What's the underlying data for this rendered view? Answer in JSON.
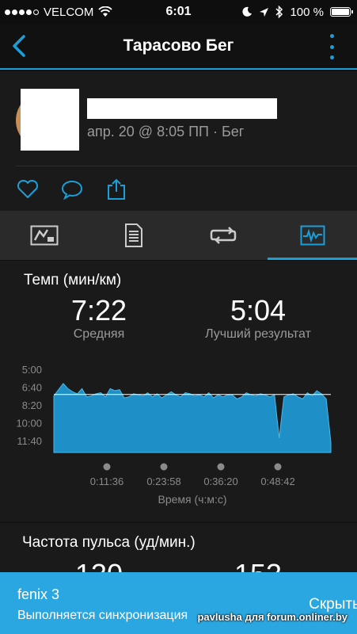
{
  "status_bar": {
    "carrier": "VELCOM",
    "time": "6:01",
    "battery": "100 %",
    "battery_level": 1.0,
    "signal_bars": 4
  },
  "header": {
    "title": "Тарасово Бег"
  },
  "activity": {
    "meta": "апр. 20 @ 8:05 ПП · Бег"
  },
  "icons": {
    "back": "chevron-left-icon",
    "more": "more-vertical-icon",
    "like": "heart-icon",
    "comment": "comment-icon",
    "share": "share-icon",
    "tab_overview": "map-icon",
    "tab_details": "document-icon",
    "tab_laps": "repeat-icon",
    "tab_charts": "chart-icon"
  },
  "colors": {
    "accent": "#1a9fd9",
    "chart_fill": "#1f8fc7",
    "banner": "#2aa7e0"
  },
  "pace": {
    "title": "Темп (мин/км)",
    "avg_value": "7:22",
    "avg_label": "Средняя",
    "best_value": "5:04",
    "best_label": "Лучший результат"
  },
  "chart_data": {
    "type": "area",
    "title": "",
    "xlabel": "Время (ч:м:с)",
    "ylabel": "",
    "y_tick_labels": [
      "5:00",
      "6:40",
      "8:20",
      "10:00",
      "11:40"
    ],
    "x_tick_labels": [
      "0:11:36",
      "0:23:58",
      "0:36:20",
      "0:48:42"
    ],
    "y_inverted": true,
    "y_range_min_per_km": [
      5.0,
      13.0
    ],
    "average_line_min_per_km": 7.37,
    "x_range_min": [
      0,
      59
    ],
    "series": [
      {
        "x_min": [
          0,
          1,
          2,
          3,
          4,
          5,
          6,
          7,
          8,
          9,
          10,
          11,
          12,
          13,
          14,
          15,
          16,
          17,
          18,
          19,
          20,
          21,
          22,
          23,
          24,
          25,
          26,
          27,
          28,
          29,
          30,
          31,
          32,
          33,
          34,
          35,
          36,
          37,
          38,
          39,
          40,
          41,
          42,
          43,
          44,
          45,
          46,
          47,
          48,
          49,
          50,
          51,
          52,
          53,
          54,
          55,
          56,
          57,
          58,
          59
        ],
        "pace_min_per_km": [
          7.5,
          6.9,
          6.3,
          6.8,
          7.1,
          7.3,
          6.8,
          7.6,
          7.5,
          7.3,
          7.2,
          7.6,
          6.8,
          7.0,
          6.9,
          7.7,
          7.6,
          7.3,
          7.4,
          7.5,
          7.2,
          7.6,
          7.3,
          7.7,
          7.4,
          7.1,
          7.4,
          7.6,
          7.2,
          7.3,
          7.5,
          7.4,
          7.6,
          7.2,
          7.7,
          7.4,
          7.6,
          7.4,
          7.4,
          7.8,
          7.6,
          7.2,
          7.4,
          7.5,
          7.3,
          7.4,
          7.6,
          7.4,
          11.6,
          7.6,
          7.4,
          7.3,
          7.6,
          7.8,
          7.2,
          7.5,
          7.0,
          7.3,
          7.8,
          12.0
        ]
      }
    ]
  },
  "heart_rate": {
    "title": "Частота пульса (уд/мин.)",
    "avg_value": "130",
    "max_value": "153"
  },
  "banner": {
    "device": "fenix 3",
    "message": "Выполняется синхронизация",
    "hide_label": "Скрыть",
    "watermark": "pavlusha для forum.onliner.by"
  }
}
